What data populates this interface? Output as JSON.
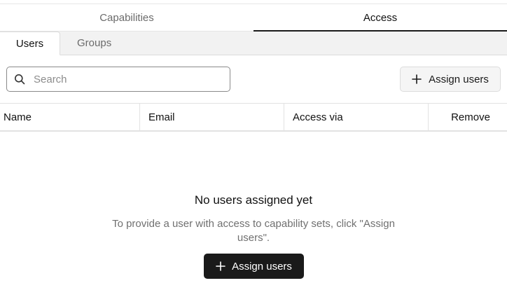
{
  "top_tabs": [
    {
      "label": "Capabilities",
      "active": false
    },
    {
      "label": "Access",
      "active": true
    }
  ],
  "sub_tabs": [
    {
      "label": "Users",
      "active": true
    },
    {
      "label": "Groups",
      "active": false
    }
  ],
  "search": {
    "placeholder": "Search",
    "value": "",
    "icon": "search-icon"
  },
  "toolbar": {
    "assign_label": "Assign users",
    "assign_icon": "plus-icon"
  },
  "table": {
    "columns": [
      "Name",
      "Email",
      "Access via",
      "Remove"
    ],
    "rows": []
  },
  "empty_state": {
    "title": "No users assigned yet",
    "description": "To provide a user with access to capability sets, click \"Assign users\".",
    "button_label": "Assign users"
  },
  "colors": {
    "primary_button": "#1a1a1a",
    "active_tab_underline": "#1a1a1a",
    "subtab_bar": "#f2f2f2"
  }
}
